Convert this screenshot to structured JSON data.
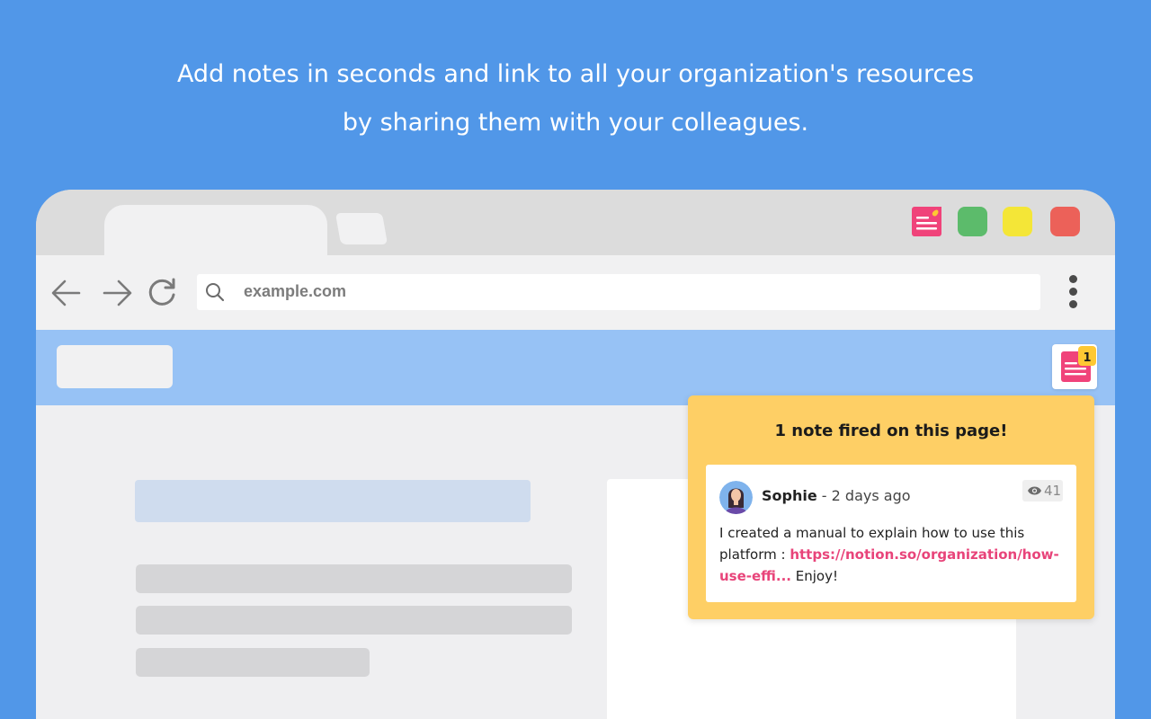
{
  "headline": {
    "line1": "Add notes in seconds and link to all your organization's resources",
    "line2": "by sharing them with your colleagues."
  },
  "browser": {
    "extensions": [
      {
        "name": "notes-extension-icon",
        "color": "#f0437a"
      },
      {
        "name": "green-extension-icon",
        "color": "#5cbb6b"
      },
      {
        "name": "yellow-extension-icon",
        "color": "#f4e637"
      },
      {
        "name": "red-extension-icon",
        "color": "#ec6159"
      }
    ],
    "address": {
      "url": "example.com"
    },
    "notes_badge": "1"
  },
  "popup": {
    "title": "1 note fired on this page!",
    "note": {
      "author": "Sophie",
      "time": " - 2 days ago",
      "views": "41",
      "body_prefix": "I created a manual to explain how to use this platform : ",
      "link_text": "https://notion.so/organization/how-use-effi...",
      "body_suffix": " Enjoy!"
    }
  },
  "colors": {
    "background": "#5197e8",
    "brand_pink": "#f0437a",
    "popup_yellow": "#fecf65",
    "page_header": "#97c2f5",
    "badge_yellow": "#fec833"
  }
}
